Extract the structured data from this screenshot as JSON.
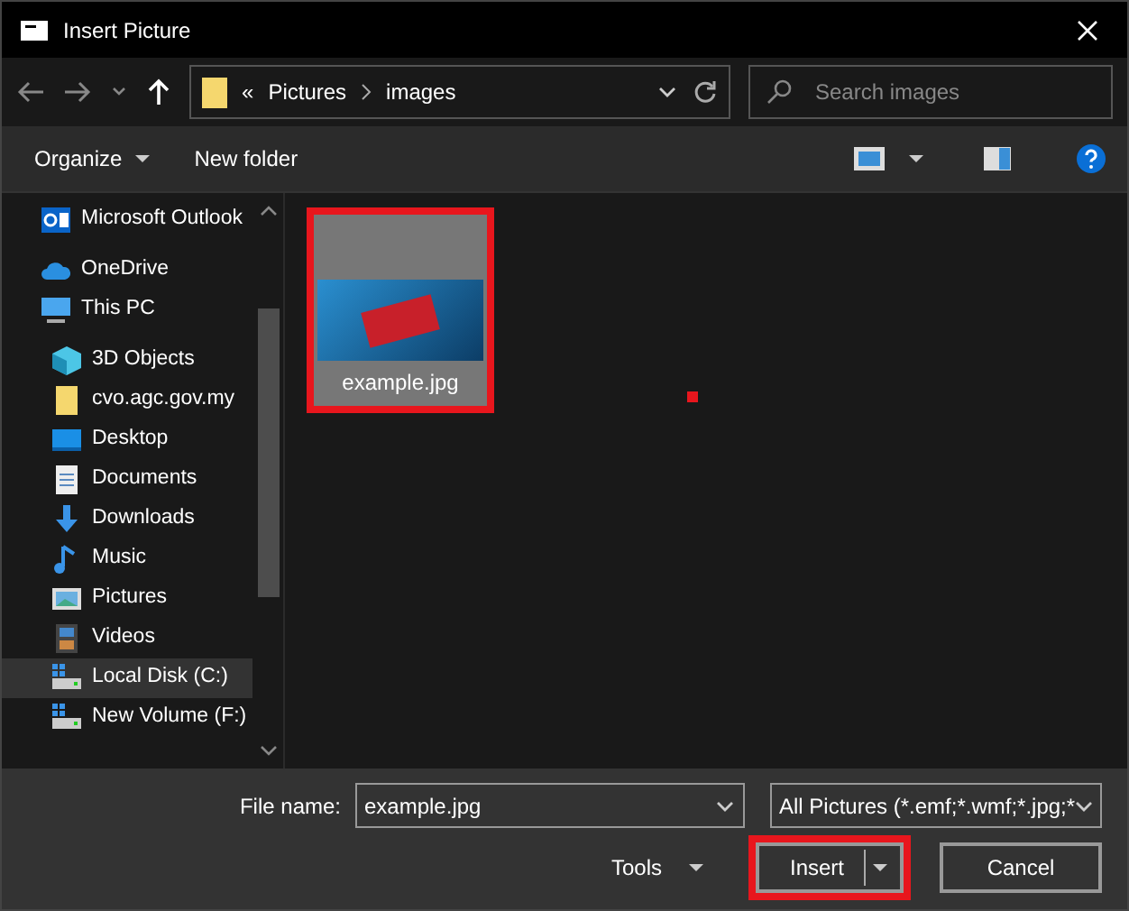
{
  "window": {
    "title": "Insert Picture"
  },
  "address_bar": {
    "overflow": "«",
    "segments": [
      "Pictures",
      "images"
    ]
  },
  "search": {
    "placeholder": "Search images"
  },
  "toolbar": {
    "buttons": [
      "Organize",
      "New folder"
    ]
  },
  "sidebar": {
    "items": [
      {
        "label": "Microsoft Outlook",
        "kind": "outlook",
        "indented": false,
        "selected": false
      },
      {
        "label": "OneDrive",
        "kind": "cloud",
        "indented": false,
        "selected": false
      },
      {
        "label": "This PC",
        "kind": "pc",
        "indented": false,
        "selected": false
      },
      {
        "label": "3D Objects",
        "kind": "cube",
        "indented": true,
        "selected": false
      },
      {
        "label": "cvo.agc.gov.my",
        "kind": "folder",
        "indented": true,
        "selected": false
      },
      {
        "label": "Desktop",
        "kind": "desktop",
        "indented": true,
        "selected": false
      },
      {
        "label": "Documents",
        "kind": "document",
        "indented": true,
        "selected": false
      },
      {
        "label": "Downloads",
        "kind": "download",
        "indented": true,
        "selected": false
      },
      {
        "label": "Music",
        "kind": "music",
        "indented": true,
        "selected": false
      },
      {
        "label": "Pictures",
        "kind": "picture",
        "indented": true,
        "selected": false
      },
      {
        "label": "Videos",
        "kind": "video",
        "indented": true,
        "selected": false
      },
      {
        "label": "Local Disk (C:)",
        "kind": "disk",
        "indented": true,
        "selected": true
      },
      {
        "label": "New Volume (F:)",
        "kind": "disk",
        "indented": true,
        "selected": false
      }
    ]
  },
  "files": [
    {
      "name": "example.jpg",
      "selected": true,
      "highlighted": true
    }
  ],
  "file_name": {
    "label": "File name:",
    "value": "example.jpg"
  },
  "file_type": {
    "value": "All Pictures (*.emf;*.wmf;*.jpg;*"
  },
  "tools": {
    "label": "Tools"
  },
  "buttons": [
    {
      "label": "Insert",
      "kind": "split",
      "highlighted": true
    },
    {
      "label": "Cancel",
      "kind": "plain",
      "highlighted": false
    }
  ]
}
